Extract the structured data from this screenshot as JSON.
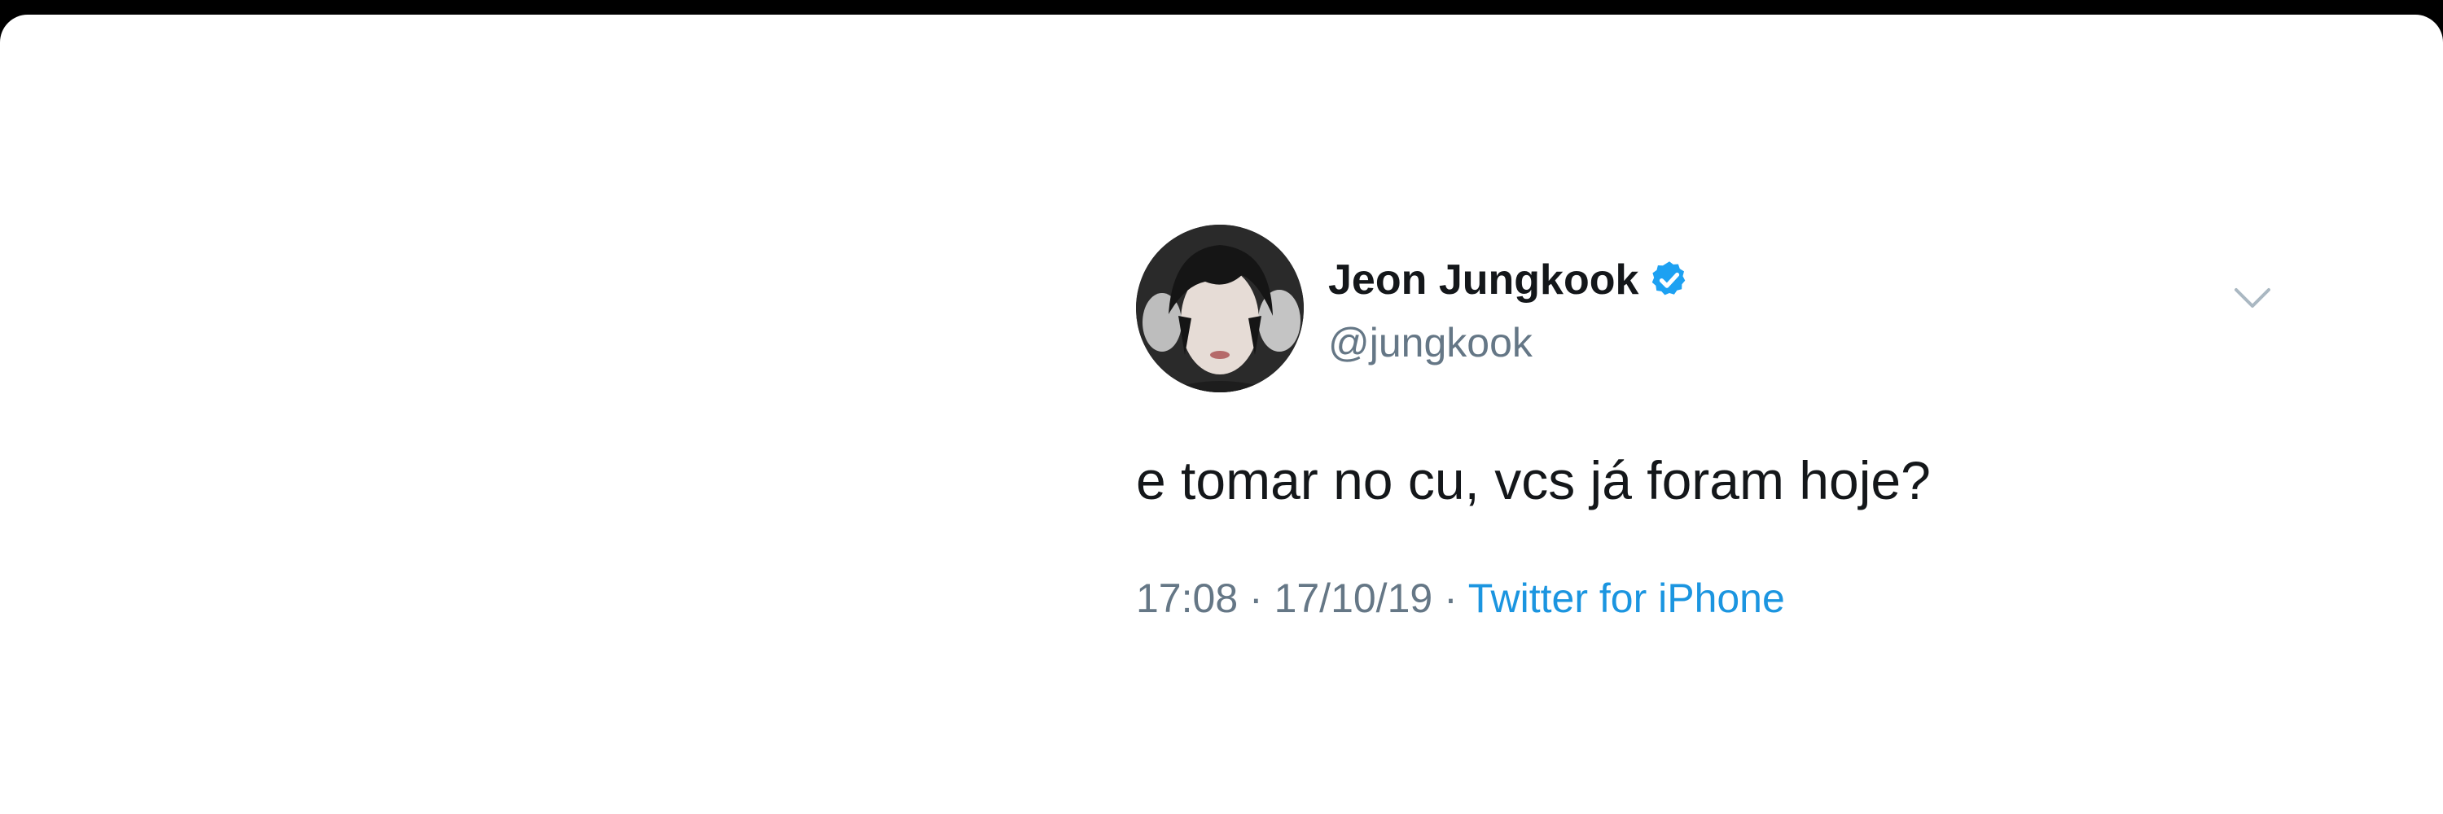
{
  "tweet": {
    "display_name": "Jeon Jungkook",
    "handle": "@jungkook",
    "text": "e tomar no cu, vcs já foram hoje?",
    "time": "17:08",
    "separator": " · ",
    "date": "17/10/19",
    "source": "Twitter for iPhone",
    "verified": true
  },
  "icons": {
    "verified": "verified-badge-icon",
    "menu": "chevron-down-icon"
  },
  "colors": {
    "name": "#14171a",
    "secondary": "#657786",
    "link": "#1b95e0",
    "verified_badge": "#1da1f2",
    "background": "#ffffff",
    "outer_border": "#000000"
  }
}
